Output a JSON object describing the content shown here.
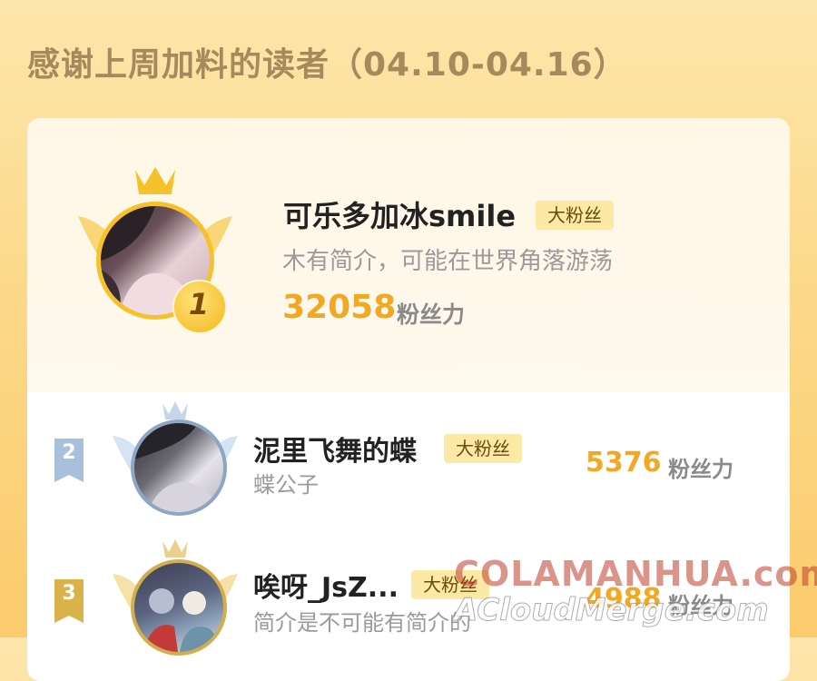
{
  "header": {
    "title": "感谢上周加料的读者（04.10-04.16）"
  },
  "ranking": [
    {
      "rank": "1",
      "name": "可乐多加冰smile",
      "badge": "大粉丝",
      "bio": "木有简介，可能在世界角落游荡",
      "score": "32058",
      "score_label": "粉丝力"
    },
    {
      "rank": "2",
      "name": "泥里飞舞的蝶",
      "badge": "大粉丝",
      "bio": "蝶公子",
      "score": "5376",
      "score_label": "粉丝力"
    },
    {
      "rank": "3",
      "name": "唉呀_JsZ...",
      "badge": "大粉丝",
      "bio": "简介是不可能有简介的",
      "score": "4988",
      "score_label": "粉丝力"
    }
  ],
  "watermark": {
    "line1": "COLAMANHUA.com",
    "line2": "ACloudMerge.com"
  },
  "colors": {
    "accent": "#f3a823",
    "gold": "#f6c22b",
    "silver": "#a9c0dd",
    "bronze": "#d9b24a"
  }
}
